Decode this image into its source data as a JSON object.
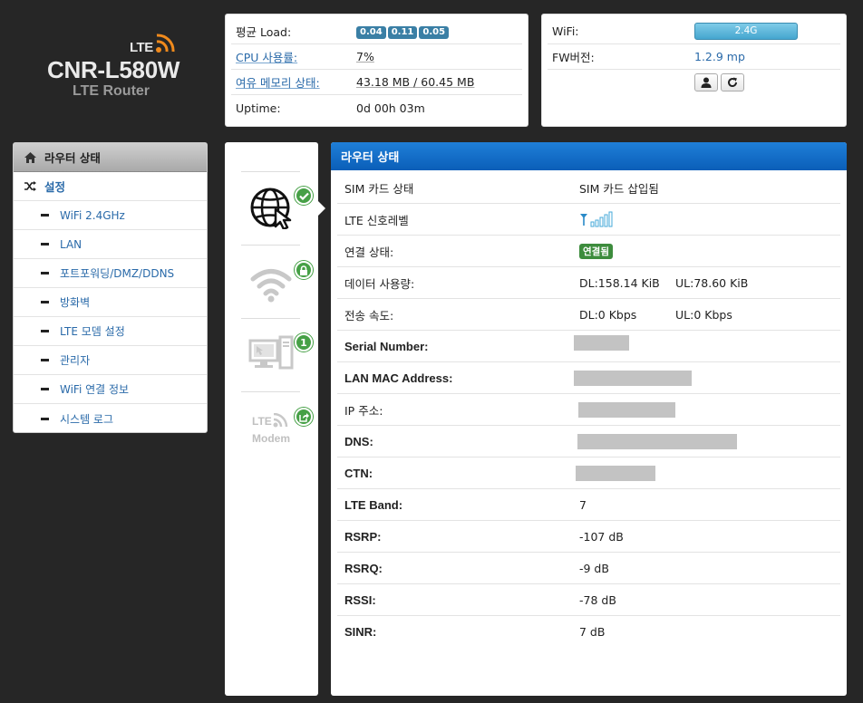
{
  "logo": {
    "badge": "LTE",
    "model": "CNR-L580W",
    "subtitle": "LTE Router"
  },
  "status": {
    "load_label": "평균 Load:",
    "load_values": [
      "0.04",
      "0.11",
      "0.05"
    ],
    "cpu_label": "CPU 사용률:",
    "cpu_value": "7%",
    "mem_label": "여유 메모리 상태:",
    "mem_value": "43.18 MB / 60.45 MB",
    "uptime_label": "Uptime:",
    "uptime_value": "0d 00h 03m"
  },
  "wifi": {
    "wifi_label": "WiFi:",
    "wifi_button": "2.4G",
    "fw_label": "FW버전:",
    "fw_value": "1.2.9 mp",
    "icons": [
      "user-icon",
      "refresh-icon"
    ]
  },
  "nav": {
    "header": "라우터 상태",
    "settings": "설정",
    "items": [
      "WiFi 2.4GHz",
      "LAN",
      "포트포워딩/DMZ/DDNS",
      "방화벽",
      "LTE 모뎀 설정",
      "관리자",
      "WiFi 연결 정보",
      "시스템 로그"
    ]
  },
  "strip": {
    "icons": [
      "globe-cursor-icon",
      "wifi-icon",
      "computer-icon",
      "lte-modem-icon"
    ],
    "badges": [
      "check-icon",
      "lock-icon",
      "1",
      "share-icon"
    ],
    "lte_text": "LTE",
    "modem_text": "Modem"
  },
  "main": {
    "title": "라우터 상태",
    "rows": [
      {
        "label": "SIM 카드 상태",
        "value": "SIM 카드 삽입됨"
      },
      {
        "label": "LTE 신호레벨",
        "value": ""
      },
      {
        "label": "연결 상태:",
        "value": "연결됨"
      },
      {
        "label": "데이터 사용량:",
        "dl": "DL:158.14 KiB",
        "ul": "UL:78.60 KiB"
      },
      {
        "label": "전송 속도:",
        "dl": "DL:0 Kbps",
        "ul": "UL:0 Kbps"
      },
      {
        "label": "Serial Number:",
        "value": ""
      },
      {
        "label": "LAN MAC Address:",
        "value": ""
      },
      {
        "label": "IP 주소:",
        "value": ""
      },
      {
        "label": "DNS:",
        "value": ""
      },
      {
        "label": "CTN:",
        "value": ""
      },
      {
        "label": "LTE Band:",
        "value": "7"
      },
      {
        "label": "RSRP:",
        "value": "-107 dB"
      },
      {
        "label": "RSRQ:",
        "value": "-9 dB"
      },
      {
        "label": "RSSI:",
        "value": "-78 dB"
      },
      {
        "label": "SINR:",
        "value": "7 dB"
      }
    ]
  },
  "colors": {
    "accent": "#0a5eb8",
    "link": "#2a6aa9",
    "success": "#46a046",
    "background": "#262626"
  }
}
